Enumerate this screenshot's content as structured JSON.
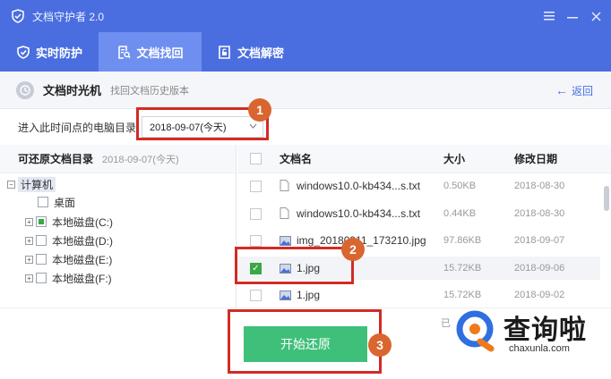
{
  "app": {
    "title": "文档守护者 2.0"
  },
  "tabs": [
    {
      "label": "实时防护",
      "icon": "shield-icon"
    },
    {
      "label": "文档找回",
      "icon": "file-search-icon",
      "active": true
    },
    {
      "label": "文档解密",
      "icon": "unlock-file-icon"
    }
  ],
  "section": {
    "title": "文档时光机",
    "subtitle": "找回文档历史版本",
    "back": "返回"
  },
  "directory": {
    "label": "进入此时间点的电脑目录",
    "selected": "2018-09-07(今天)"
  },
  "left_panel": {
    "title": "可还原文档目录",
    "date": "2018-09-07(今天)",
    "tree": [
      {
        "label": "计算机"
      },
      {
        "label": "桌面"
      },
      {
        "label": "本地磁盘(C:)"
      },
      {
        "label": "本地磁盘(D:)"
      },
      {
        "label": "本地磁盘(E:)"
      },
      {
        "label": "本地磁盘(F:)"
      }
    ]
  },
  "table": {
    "headers": {
      "name": "文档名",
      "size": "大小",
      "date": "修改日期"
    },
    "rows": [
      {
        "name": "windows10.0-kb434...s.txt",
        "size": "0.50KB",
        "date": "2018-08-30"
      },
      {
        "name": "windows10.0-kb434...s.txt",
        "size": "0.44KB",
        "date": "2018-08-30"
      },
      {
        "name": "img_20180911_173210.jpg",
        "size": "97.86KB",
        "date": "2018-09-07"
      },
      {
        "name": "1.jpg",
        "size": "15.72KB",
        "date": "2018-09-06",
        "checked": true
      },
      {
        "name": "1.jpg",
        "size": "15.72KB",
        "date": "2018-09-02"
      }
    ]
  },
  "bottom": {
    "restore": "开始还原",
    "partial_text": "已"
  },
  "annotations": {
    "b1": "1",
    "b2": "2",
    "b3": "3"
  },
  "watermark": {
    "text": "查询啦",
    "url": "chaxunla.com"
  },
  "colors": {
    "brand": "#4a6ee0",
    "highlight": "#d22b25",
    "badge": "#d9652f",
    "restore": "#3fc07a"
  }
}
